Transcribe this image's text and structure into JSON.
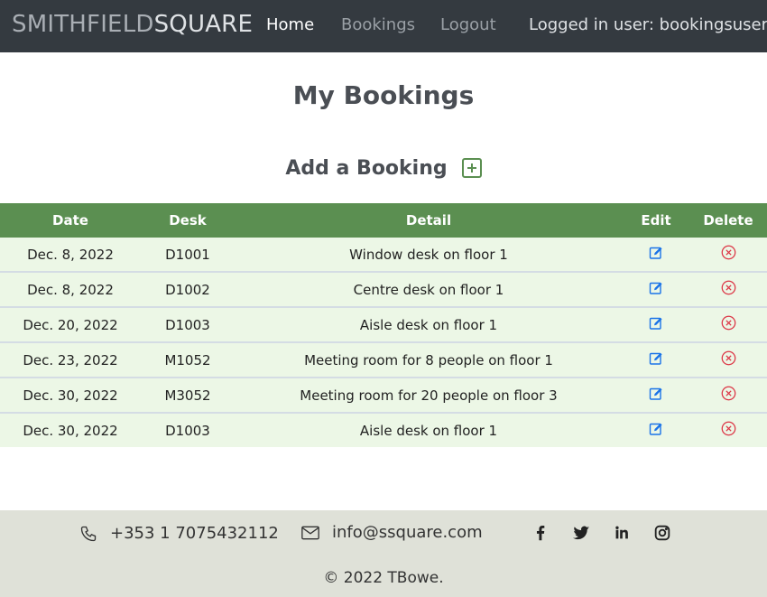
{
  "navbar": {
    "brand_part1": "SMITHFIELD",
    "brand_part2": "SQUARE",
    "links": [
      "Home",
      "Bookings",
      "Logout"
    ],
    "user_text": "Logged in user: bookingsuser"
  },
  "page": {
    "title": "My Bookings",
    "add_label": "Add a Booking"
  },
  "table": {
    "headers": [
      "Date",
      "Desk",
      "Detail",
      "Edit",
      "Delete"
    ],
    "rows": [
      {
        "date": "Dec. 8, 2022",
        "desk": "D1001",
        "detail": "Window desk on floor 1"
      },
      {
        "date": "Dec. 8, 2022",
        "desk": "D1002",
        "detail": "Centre desk on floor 1"
      },
      {
        "date": "Dec. 20, 2022",
        "desk": "D1003",
        "detail": "Aisle desk on floor 1"
      },
      {
        "date": "Dec. 23, 2022",
        "desk": "M1052",
        "detail": "Meeting room for 8 people on floor 1"
      },
      {
        "date": "Dec. 30, 2022",
        "desk": "M3052",
        "detail": "Meeting room for 20 people on floor 3"
      },
      {
        "date": "Dec. 30, 2022",
        "desk": "D1003",
        "detail": "Aisle desk on floor 1"
      }
    ]
  },
  "footer": {
    "phone": "+353 1 7075432112",
    "email": "info@ssquare.com",
    "social_icons": [
      "facebook-icon",
      "twitter-icon",
      "linkedin-icon",
      "instagram-icon"
    ],
    "copyright": "© 2022 TBowe."
  },
  "colors": {
    "navbar_bg": "#343a40",
    "table_header_bg": "#5b8f51",
    "row_bg": "#ecf7e6",
    "edit_icon": "#1a73e8",
    "delete_icon": "#dc3545",
    "footer_bg": "#dfe1d8"
  }
}
